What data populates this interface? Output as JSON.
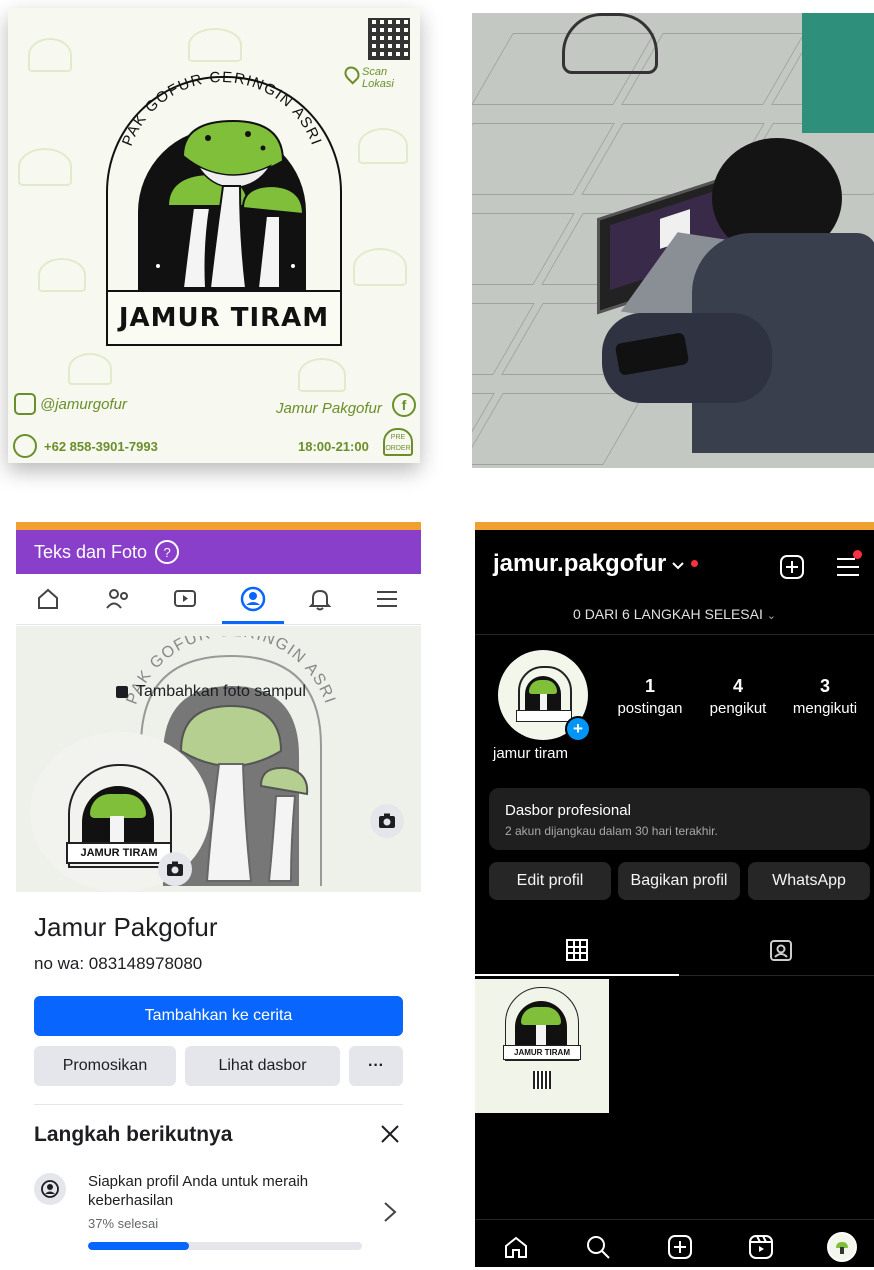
{
  "poster": {
    "brand_arc": "PAK GOFUR CERINGIN ASRI",
    "title": "JAMUR TIRAM",
    "scan_label": "Scan Lokasi",
    "instagram": "@jamurgofur",
    "facebook": "Jamur Pakgofur",
    "whatsapp": "+62 858-3901-7993",
    "hours": "18:00-21:00",
    "preorder_top": "PRE",
    "preorder_bottom": "ORDER",
    "accent": "#6a8f2a"
  },
  "facebook": {
    "header_title": "Teks dan Foto",
    "help_glyph": "?",
    "add_cover": "Tambahkan foto sampul",
    "cover_arc": "PAK GOFUR CERINGIN ASRI",
    "logo_title": "JAMUR TIRAM",
    "profile_name": "Jamur Pakgofur",
    "bio": "no wa: 083148978080",
    "add_story": "Tambahkan ke cerita",
    "promote": "Promosikan",
    "view_dashboard": "Lihat dasbor",
    "more": "···",
    "next_steps": "Langkah berikutnya",
    "step_title": "Siapkan profil Anda untuk meraih keberhasilan",
    "step_progress_label": "37% selesai",
    "step_progress": 0.37,
    "brand_blue": "#0866ff",
    "header_purple": "#8a3fcb"
  },
  "instagram": {
    "username": "jamur.pakgofur",
    "steps": "0 DARI 6 LANGKAH SELESAI",
    "posts_count": "1",
    "posts_label": "postingan",
    "followers_count": "4",
    "followers_label": "pengikut",
    "following_count": "3",
    "following_label": "mengikuti",
    "display_name": "jamur tiram",
    "dashboard_title": "Dasbor profesional",
    "dashboard_sub": "2 akun dijangkau dalam 30 hari terakhir.",
    "edit_profile": "Edit profil",
    "share_profile": "Bagikan profil",
    "whatsapp": "WhatsApp",
    "thumb_title": "JAMUR TIRAM"
  }
}
